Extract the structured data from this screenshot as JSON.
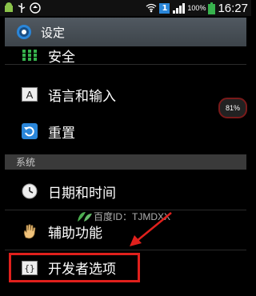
{
  "status_bar": {
    "battery_percent": "100%",
    "time": "16:27",
    "notification_count": "1",
    "icons": [
      "android-icon",
      "usb-icon",
      "sync-icon",
      "wifi-icon",
      "signal-icon",
      "battery-icon"
    ]
  },
  "title_bar": {
    "title": "设定",
    "icon": "settings-gear-icon"
  },
  "items": [
    {
      "label": "安全",
      "icon": "security-grid-icon"
    },
    {
      "label": "语言和输入",
      "icon": "keyboard-a-icon"
    },
    {
      "label": "重置",
      "icon": "reset-icon"
    },
    {
      "label": "日期和时间",
      "icon": "clock-icon"
    },
    {
      "label": "辅助功能",
      "icon": "hand-icon"
    },
    {
      "label": "开发者选项",
      "icon": "braces-icon"
    }
  ],
  "section": {
    "title": "系统"
  },
  "overlay": {
    "memory_badge": "81%",
    "watermark": "百度ID：TJMDXX"
  },
  "colors": {
    "highlight": "#e0201c",
    "accent_green": "#37b24d",
    "accent_blue": "#2a86d9"
  }
}
